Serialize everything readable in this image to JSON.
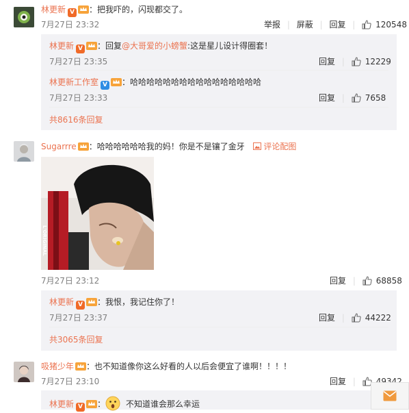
{
  "comments": [
    {
      "user": "林更新",
      "text": "：把我吓的，闪现都交了。",
      "time": "7月27日 23:32",
      "actions": {
        "report": "举报",
        "block": "屏蔽",
        "reply": "回复"
      },
      "likes": "120548",
      "replies": [
        {
          "user": "林更新",
          "text_prefix": "：回复",
          "mention": "@大哥爱的小螃蟹",
          "text_suffix": ":这是星儿设计得圈套！",
          "time": "7月27日 23:35",
          "reply": "回复",
          "likes": "12229"
        },
        {
          "user": "林更新工作室",
          "text": "：哈哈哈哈哈哈哈哈哈哈哈哈哈哈哈哈",
          "time": "7月27日 23:33",
          "reply": "回复",
          "likes": "7658"
        }
      ],
      "more_replies": "共8616条回复"
    },
    {
      "user": "Sugarrre",
      "text": "：哈哈哈哈哈哈我的妈！你是不是镶了金牙",
      "comment_image_label": "评论配图",
      "photo_text": "L'ORIGINAL",
      "time": "7月27日 23:12",
      "reply": "回复",
      "likes": "68858",
      "replies": [
        {
          "user": "林更新",
          "text": "：我恨，我记住你了！",
          "time": "7月27日 23:37",
          "reply": "回复",
          "likes": "44222"
        }
      ],
      "more_replies": "共3065条回复"
    },
    {
      "user": "吸猪少年",
      "text": "：也不知道像你这么好看的人以后会便宜了谁啊！！！！",
      "time": "7月27日 23:10",
      "reply": "回复",
      "likes": "49342",
      "replies": [
        {
          "user": "林更新",
          "text": "不知道谁会那么幸运"
        }
      ]
    }
  ],
  "colors": {
    "accent": "#eb7350",
    "reply_bg": "#f2f2f5",
    "badge": "#f06a28",
    "verified_blue": "#2f8de4"
  }
}
